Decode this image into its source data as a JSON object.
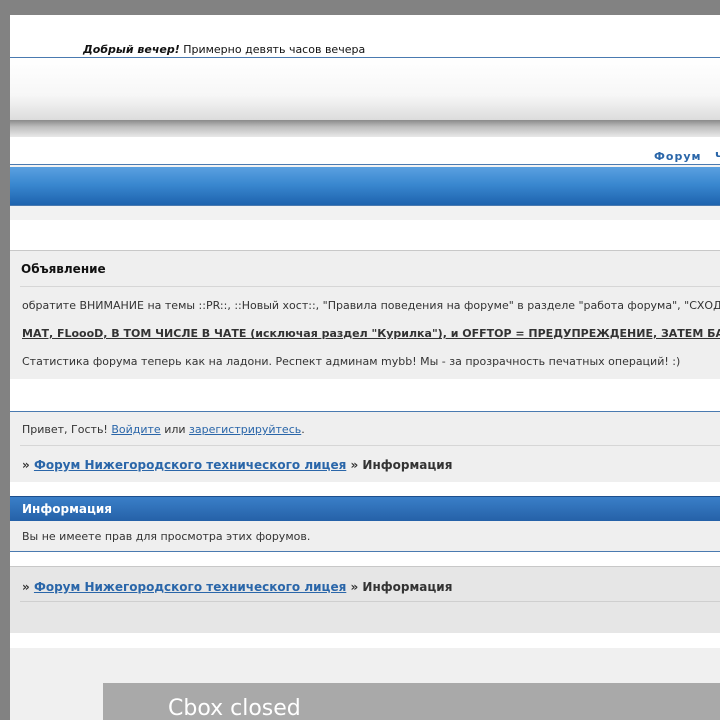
{
  "greeting": {
    "bold": "Добрый вечер!",
    "rest": " Примерно девять часов вечера"
  },
  "nav": {
    "items": [
      {
        "label": "Форум"
      },
      {
        "label": "Ч"
      }
    ]
  },
  "announcement": {
    "title": "Объявление",
    "lines": [
      "обратите ВНИМАНИЕ на темы ::PR::, ::Новый хост::, \"Правила поведения на форуме\" в разделе \"работа форума\", \"СХОД",
      "МАТ, FLoooD, В ТОМ ЧИСЛЕ В ЧАТЕ (исключая раздел \"Курилка\"), и OFFTOP = ПРЕДУПРЕЖДЕНИЕ, ЗАТЕМ БА",
      "Статистика форума теперь как на ладони. Респект админам mybb! Мы - за прозрачность печатных операций! :)"
    ]
  },
  "welcome": {
    "prefix": "Привет, Гость! ",
    "login": "Войдите",
    "or": " или ",
    "register": "зарегистрируйтесь",
    "suffix": "."
  },
  "breadcrumb": {
    "sep": "» ",
    "forum": "Форум Нижегородского технического лицея",
    "sep2": " » ",
    "current": "Информация"
  },
  "info": {
    "title": "Информация",
    "message": "Вы не имеете прав для просмотра этих форумов."
  },
  "cbox": {
    "label": "Cbox closed"
  },
  "colors": {
    "accent": "#2a66a9",
    "header_blue": "#3a88d0",
    "background": "#828282"
  }
}
